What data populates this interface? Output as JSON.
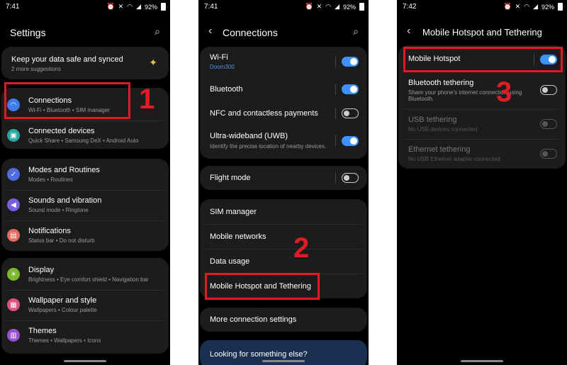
{
  "status": {
    "p1_time": "7:41",
    "p2_time": "7:41",
    "p3_time": "7:42",
    "battery": "92%"
  },
  "panel1": {
    "title": "Settings",
    "banner_title": "Keep your data safe and synced",
    "banner_sub": "2 more suggestions",
    "items": [
      {
        "label": "Connections",
        "sub": "Wi-Fi  •  Bluetooth  •  SIM manager",
        "color": "#3d7be8"
      },
      {
        "label": "Connected devices",
        "sub": "Quick Share  •  Samsung DeX  •  Android Auto",
        "color": "#2aa8a0"
      },
      {
        "label": "Modes and Routines",
        "sub": "Modes  •  Routines",
        "color": "#4f6ee0"
      },
      {
        "label": "Sounds and vibration",
        "sub": "Sound mode  •  Ringtone",
        "color": "#7a5ee0"
      },
      {
        "label": "Notifications",
        "sub": "Status bar  •  Do not disturb",
        "color": "#e06b5e"
      },
      {
        "label": "Display",
        "sub": "Brightness  •  Eye comfort shield  •  Navigation bar",
        "color": "#7ab82e"
      },
      {
        "label": "Wallpaper and style",
        "sub": "Wallpapers  •  Colour palette",
        "color": "#e0507a"
      },
      {
        "label": "Themes",
        "sub": "Themes  •  Wallpapers  •  Icons",
        "color": "#9a4fd0"
      }
    ],
    "step": "1"
  },
  "panel2": {
    "title": "Connections",
    "wifi_label": "Wi-Fi",
    "wifi_sub": "Doom300",
    "bluetooth": "Bluetooth",
    "nfc": "NFC and contactless payments",
    "uwb": "Ultra-wideband (UWB)",
    "uwb_sub": "Identify the precise location of nearby devices.",
    "flight": "Flight mode",
    "sim": "SIM manager",
    "mobile_networks": "Mobile networks",
    "data_usage": "Data usage",
    "hotspot": "Mobile Hotspot and Tethering",
    "more": "More connection settings",
    "looking": "Looking for something else?",
    "step": "2"
  },
  "panel3": {
    "title": "Mobile Hotspot and Tethering",
    "hotspot": "Mobile Hotspot",
    "bt_tether": "Bluetooth tethering",
    "bt_tether_sub1": "Share your phone's internet connection using",
    "bt_tether_sub2": "Bluetooth.",
    "usb": "USB tethering",
    "usb_sub": "No USB devices connected",
    "eth": "Ethernet tethering",
    "eth_sub": "No USB Ethernet adapter connected",
    "step": "3"
  }
}
